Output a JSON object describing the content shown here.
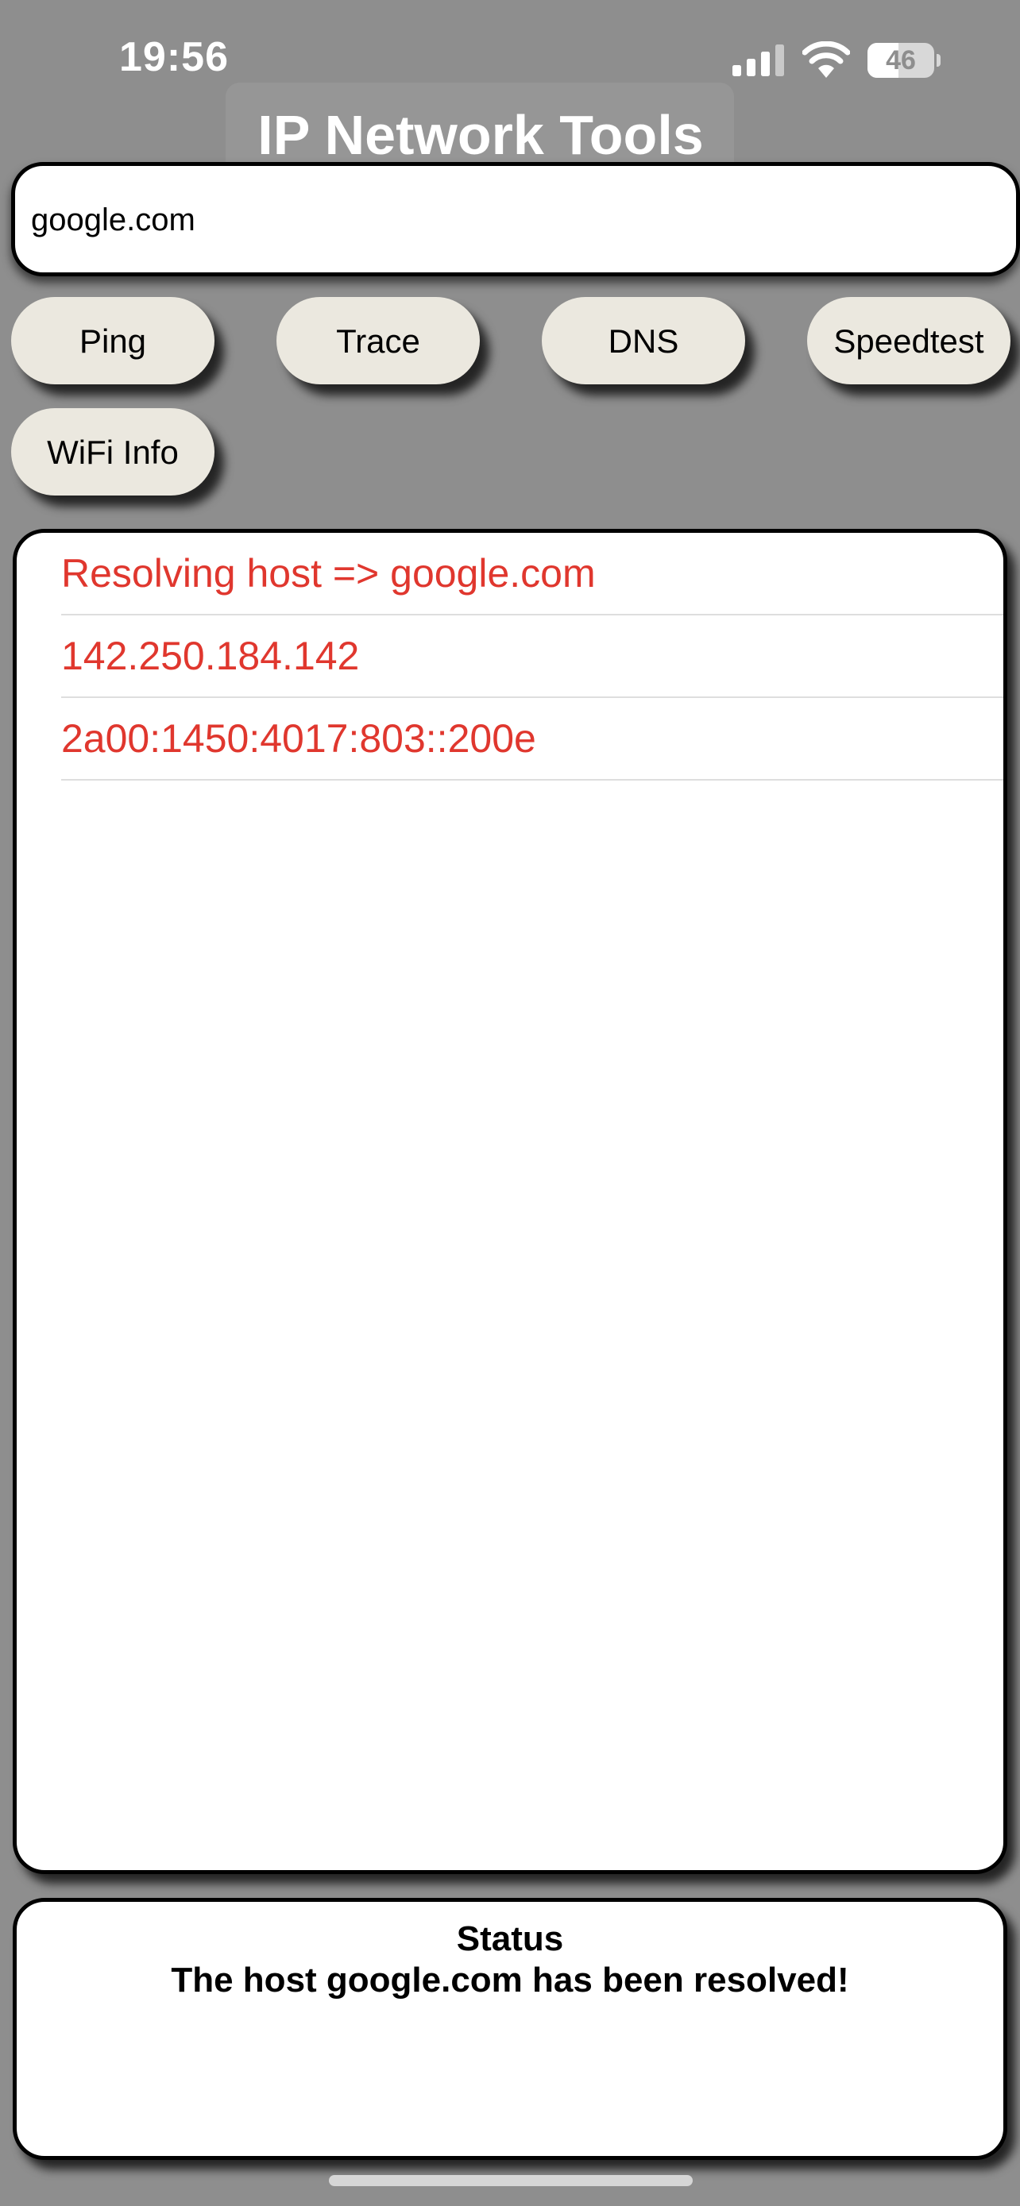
{
  "status_bar": {
    "time": "19:56",
    "battery_level": "46",
    "battery_fraction": 0.46,
    "icons": [
      "signal-icon",
      "wifi-icon",
      "battery-icon"
    ]
  },
  "app": {
    "title": "IP Network Tools"
  },
  "host_input": {
    "value": "google.com"
  },
  "tools": {
    "ping": "Ping",
    "trace": "Trace",
    "dns": "DNS",
    "speedtest": "Speedtest",
    "wifi_info": "WiFi Info"
  },
  "results": [
    {
      "text": "Resolving host => google.com"
    },
    {
      "text": "142.250.184.142"
    },
    {
      "text": "2a00:1450:4017:803::200e"
    }
  ],
  "status": {
    "heading": "Status",
    "message": "The host google.com has been resolved!"
  },
  "colors": {
    "background": "#8e8e8e",
    "button_fill": "#ebe8df",
    "result_text": "#e0372e",
    "panel_fill": "#ffffff",
    "panel_border": "#000000"
  }
}
